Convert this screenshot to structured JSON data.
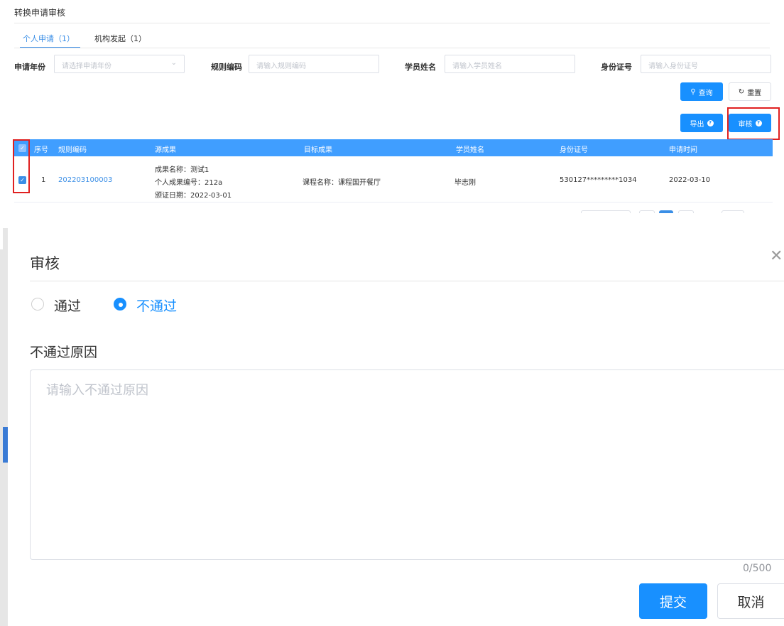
{
  "page": {
    "title": "转换申请审核"
  },
  "tabs": [
    {
      "label": "个人申请（1）",
      "active": true
    },
    {
      "label": "机构发起（1）",
      "active": false
    }
  ],
  "filters": {
    "year": {
      "label": "申请年份",
      "placeholder": "请选择申请年份"
    },
    "rule": {
      "label": "规则编码",
      "placeholder": "请输入规则编码"
    },
    "name": {
      "label": "学员姓名",
      "placeholder": "请输入学员姓名"
    },
    "idcard": {
      "label": "身份证号",
      "placeholder": "请输入身份证号"
    }
  },
  "actions": {
    "search": "查询",
    "reset": "重置",
    "export": "导出",
    "audit": "审核"
  },
  "table": {
    "headers": [
      "序号",
      "规则编码",
      "源成果",
      "目标成果",
      "学员姓名",
      "身份证号",
      "申请时间"
    ],
    "rows": [
      {
        "index": "1",
        "code": "202203100003",
        "source_name": "成果名称：测试1",
        "source_no": "个人成果编号：212a",
        "source_date": "颁证日期：2022-03-01",
        "target": "课程名称：课程国开餐厅",
        "student": "毕志刚",
        "idcard": "530127*********1034",
        "apply_time": "2022-03-10"
      }
    ]
  },
  "modal": {
    "title": "审核",
    "options": [
      {
        "label": "通过",
        "checked": false
      },
      {
        "label": "不通过",
        "checked": true
      }
    ],
    "reason_label": "不通过原因",
    "reason_placeholder": "请输入不通过原因",
    "counter": "0/500",
    "submit": "提交",
    "cancel": "取消"
  },
  "colors": {
    "primary": "#1890ff",
    "highlight": "#e02020"
  }
}
